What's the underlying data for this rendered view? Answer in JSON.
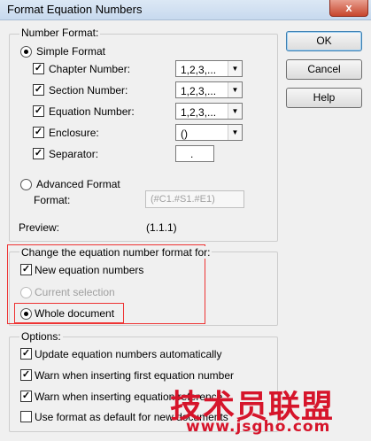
{
  "window": {
    "title": "Format Equation Numbers",
    "close_glyph": "x"
  },
  "number_format": {
    "legend": "Number Format:",
    "simple_label": "Simple Format",
    "rows": [
      {
        "label": "Chapter Number:",
        "value": "1,2,3,..."
      },
      {
        "label": "Section Number:",
        "value": "1,2,3,..."
      },
      {
        "label": "Equation Number:",
        "value": "1,2,3,..."
      },
      {
        "label": "Enclosure:",
        "value": "()"
      },
      {
        "label": "Separator:",
        "value": "."
      }
    ],
    "advanced_label": "Advanced Format",
    "format_label": "Format:",
    "format_value": "(#C1.#S1.#E1)",
    "preview_label": "Preview:",
    "preview_value": "(1.1.1)"
  },
  "change_group": {
    "legend": "Change the equation number format for:",
    "new_equations_label": "New equation numbers",
    "current_selection_label": "Current selection",
    "whole_document_label": "Whole document"
  },
  "options": {
    "legend": "Options:",
    "items": [
      {
        "label": "Update equation numbers automatically",
        "checked": true
      },
      {
        "label": "Warn when inserting first equation number",
        "checked": true
      },
      {
        "label": "Warn when inserting equation reference",
        "checked": true
      },
      {
        "label": "Use format as default for new documents",
        "checked": false
      }
    ]
  },
  "buttons": {
    "ok": "OK",
    "cancel": "Cancel",
    "help": "Help"
  },
  "watermark": {
    "line1": "技术员联盟",
    "line2": "www.jsgho.com"
  },
  "colors": {
    "highlight_box": "#ee3333",
    "watermark": "#d6152b"
  }
}
